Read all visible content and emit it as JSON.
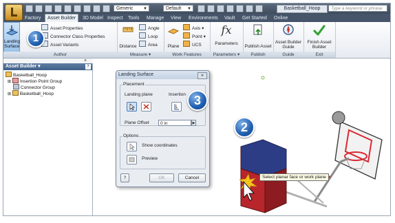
{
  "titlebar": {
    "style_select": "Generic",
    "display_select": "Default",
    "document_title": "Basketball_Hoop",
    "search_placeholder": "Type a keyword or phrase"
  },
  "tabs": [
    "Factory",
    "Asset Builder",
    "3D Model",
    "Inspect",
    "Tools",
    "Manage",
    "View",
    "Environments",
    "Vault",
    "Get Started",
    "Online"
  ],
  "active_tab": "Asset Builder",
  "ribbon": {
    "author": {
      "footer": "Author",
      "landing_surface": "Landing Surface",
      "asset_properties": "Asset Properties",
      "connector_class_properties": "Connector Class Properties",
      "asset_variants": "Asset Variants"
    },
    "measure": {
      "footer": "Measure ▾",
      "distance": "Distance",
      "angle": "Angle",
      "loop": "Loop",
      "area": "Area"
    },
    "work_features": {
      "footer": "Work Features",
      "plane": "Plane",
      "axis": "Axis ▾",
      "point": "Point ▾",
      "ucs": "UCS"
    },
    "parameters": {
      "footer": "Parameters ▾",
      "parameters": "Parameters",
      "fx_symbol": "fx"
    },
    "publish": {
      "footer": "Publish",
      "publish_asset": "Publish Asset"
    },
    "guide": {
      "footer": "Guide",
      "asset_builder_guide": "Asset Builder Guide"
    },
    "exit": {
      "footer": "Exit",
      "finish_asset_builder": "Finish Asset Builder"
    }
  },
  "browser": {
    "header": "Asset Builder ▾",
    "help": "?",
    "close": "×",
    "items": [
      "Basketball_Hoop",
      "Insertion Point Group",
      "Connector Group",
      "Basketball_Hoop"
    ]
  },
  "dialog": {
    "title": "Landing Surface",
    "close": "⨯",
    "placement_label": "Placement",
    "landing_plane_label": "Landing plane",
    "insertion_label": "Insertion",
    "plane_offset_label": "Plane Offset",
    "plane_offset_value": "0 in",
    "options_label": "Options",
    "show_coordinates": "Show coordinates",
    "preview": "Preview",
    "help": "?",
    "ok": "OK",
    "cancel": "Cancel"
  },
  "callouts": [
    "1",
    "2",
    "3"
  ],
  "tooltip": "Select planar face or work plane",
  "colors": {
    "ribbon_bg": "#e7ebf1",
    "tab_bar": "#46556a",
    "badge_blue": "#1f5fb0",
    "hoop_base_red": "#b8262c",
    "hoop_base_blue": "#2c3d86",
    "board_red": "#d9282f"
  }
}
